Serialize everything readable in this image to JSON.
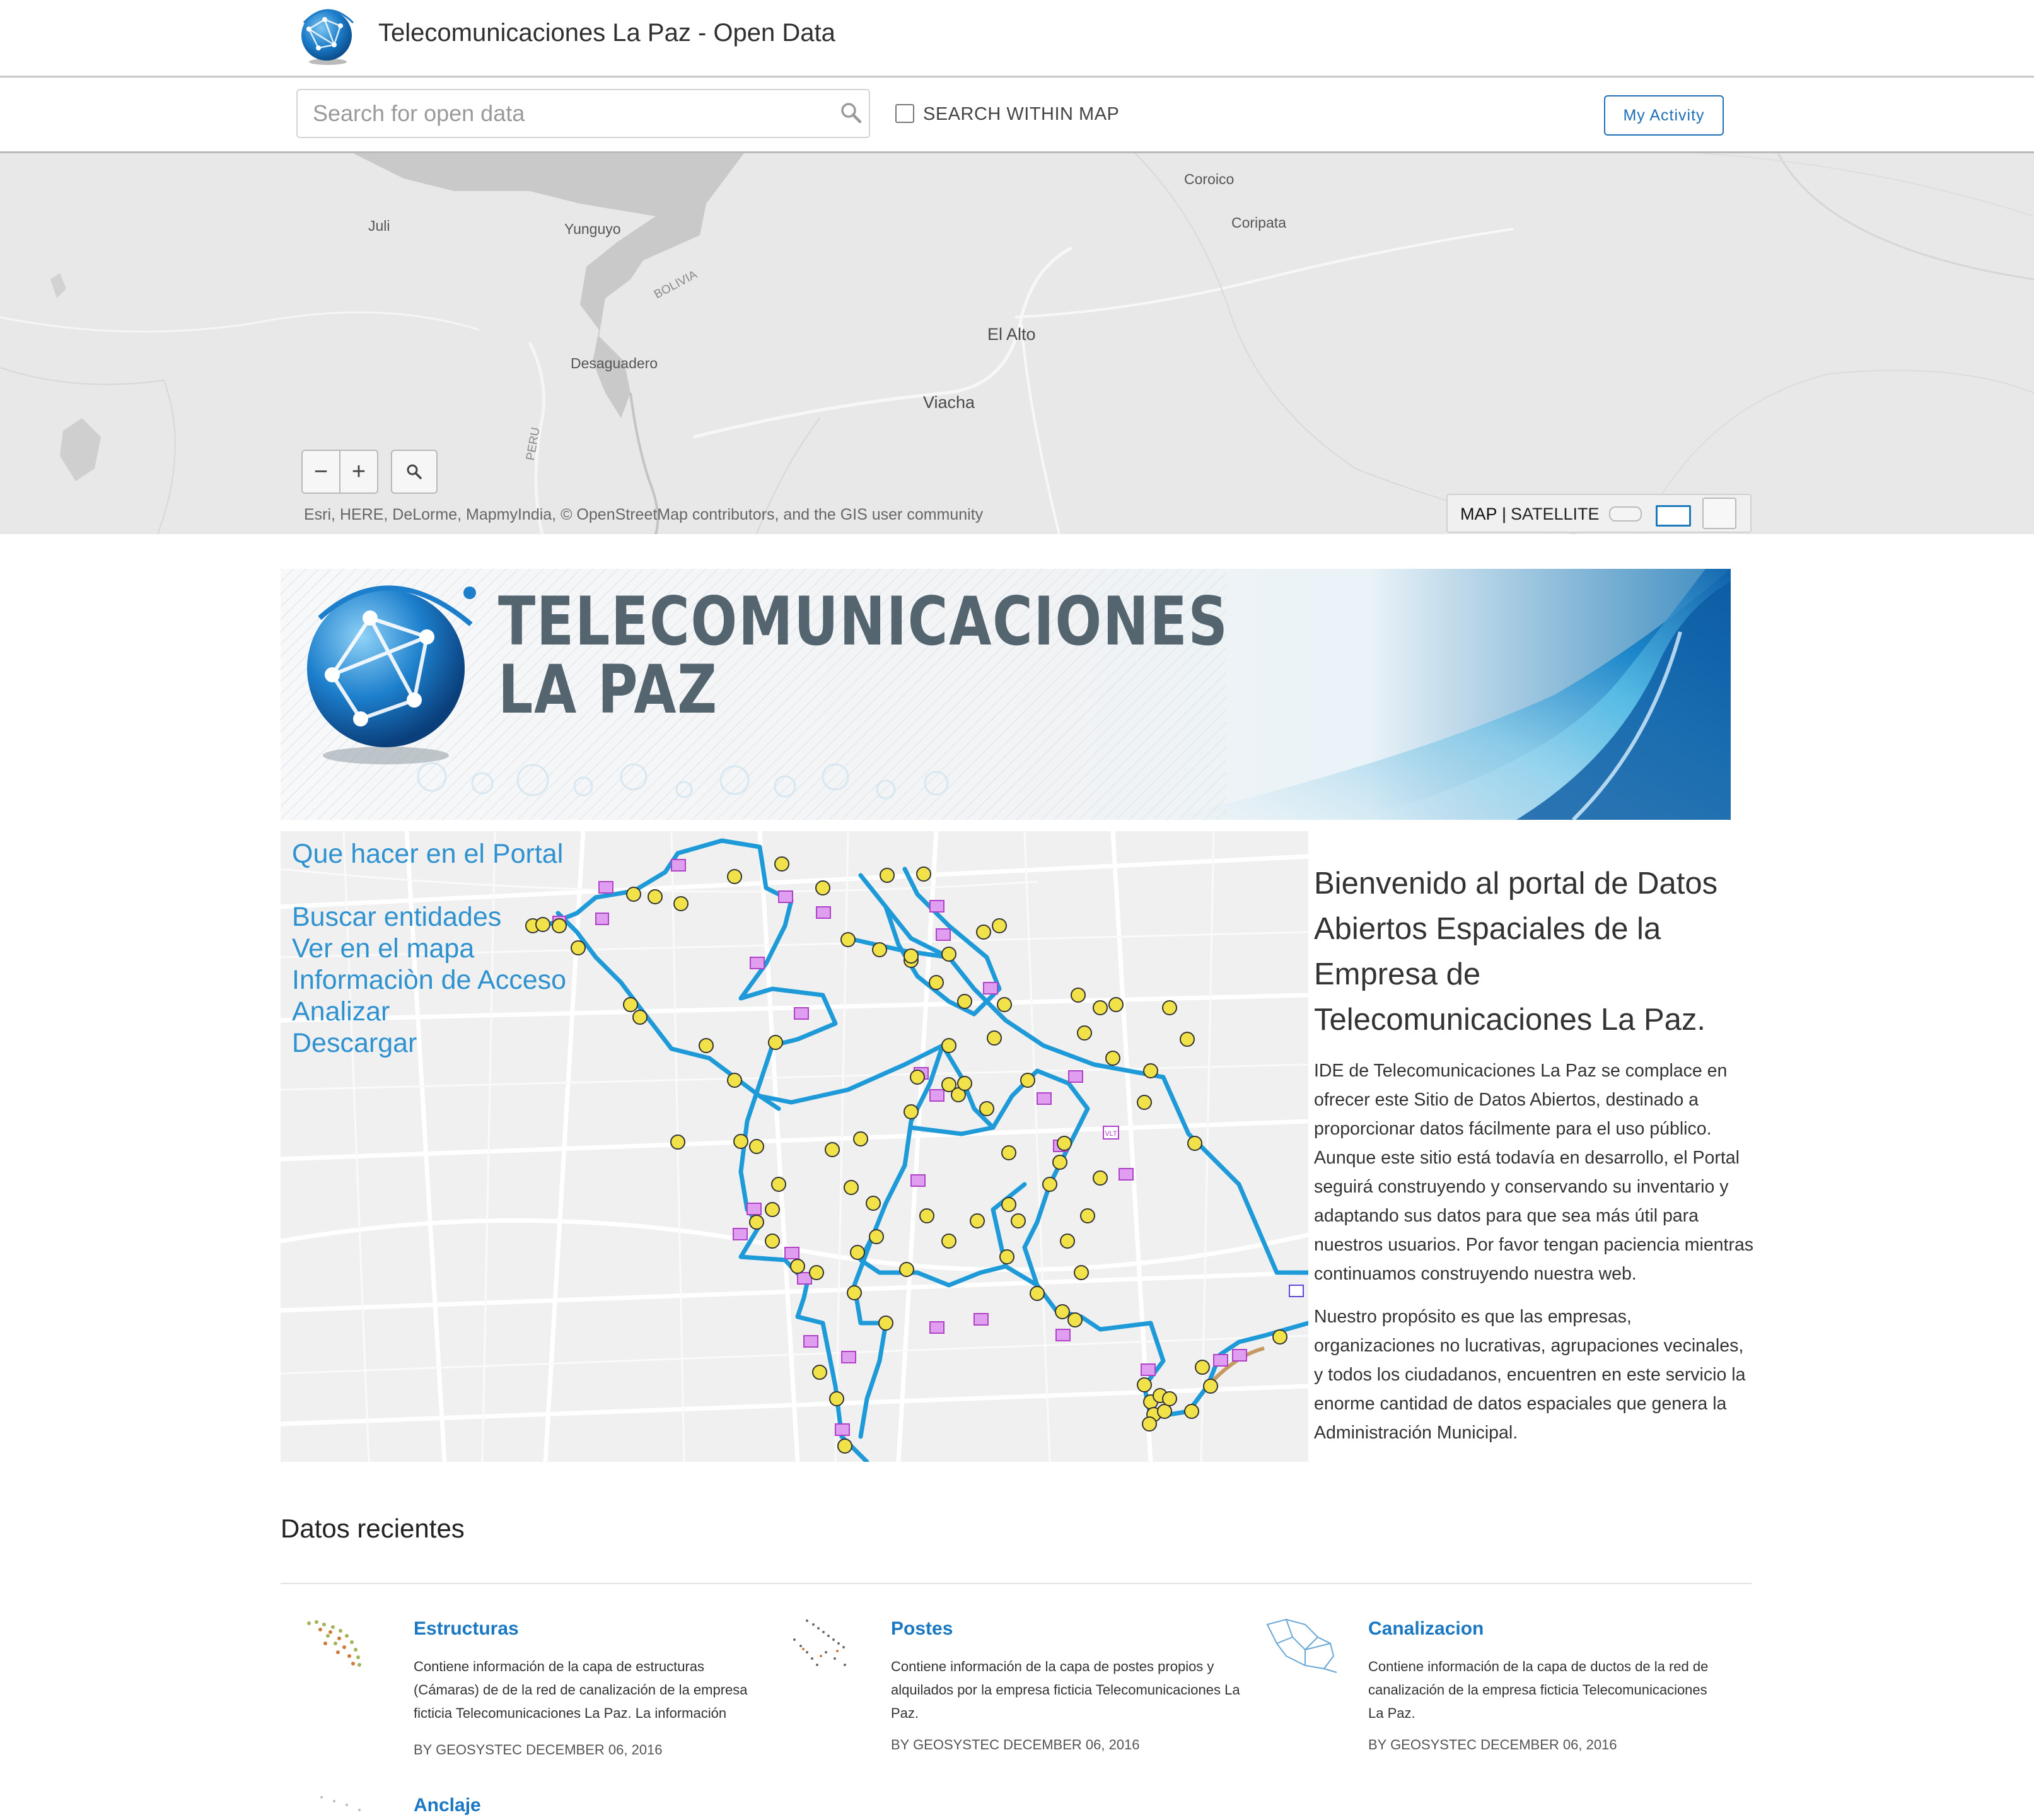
{
  "header": {
    "title": "Telecomunicaciones La Paz - Open Data"
  },
  "search": {
    "placeholder": "Search for open data",
    "within_map_label": "SEARCH WITHIN MAP",
    "my_activity_label": "My Activity"
  },
  "map": {
    "place_labels": [
      "Juli",
      "Yunguyo",
      "BOLIVIA",
      "Desaguadero",
      "PERU",
      "El Alto",
      "Viacha",
      "Coroico",
      "Coripata"
    ],
    "zoom_out": "−",
    "zoom_in": "+",
    "attribution": "Esri, HERE, DeLorme, MapmyIndia, © OpenStreetMap contributors, and the GIS user community",
    "basemap_map": "MAP",
    "basemap_separator": "|",
    "basemap_satellite": "SATELLITE"
  },
  "banner": {
    "line1": "TELECOMUNICACIONES",
    "line2": "LA PAZ"
  },
  "portal": {
    "heading": "Que hacer en el Portal",
    "links": [
      "Buscar entidades",
      "Ver en el mapa",
      "Informaciòn de Acceso",
      "Analizar",
      "Descargar"
    ],
    "map_marker_label": "VLT"
  },
  "welcome": {
    "heading": "Bienvenido al portal de Datos Abiertos Espaciales de la Empresa de Telecomunicaciones La Paz.",
    "paragraph1": "IDE de Telecomunicaciones La Paz se complace en ofrecer este Sitio de Datos Abiertos, destinado a proporcionar datos fácilmente para el uso público. Aunque este sitio está todavía en desarrollo, el Portal seguirá construyendo y conservando su inventario y adaptando sus datos para que sea más útil para nuestros usuarios. Por favor tengan paciencia mientras continuamos construyendo nuestra web.",
    "paragraph2": "Nuestro propósito es que las empresas, organizaciones no lucrativas, agrupaciones vecinales, y todos los ciudadanos, encuentren en este servicio la enorme cantidad de datos espaciales que genera la Administración Municipal."
  },
  "recent": {
    "heading": "Datos recientes",
    "items": [
      {
        "title": "Estructuras",
        "description": "Contiene información de la capa de estructuras (Cámaras) de de la red de canalización de la empresa ficticia Telecomunicaciones La Paz. La información",
        "meta": "BY GEOSYSTEC DECEMBER 06, 2016"
      },
      {
        "title": "Postes",
        "description": "Contiene información de la capa de postes propios y alquilados por la empresa ficticia Telecomunicaciones La Paz.",
        "meta": "BY GEOSYSTEC DECEMBER 06, 2016"
      },
      {
        "title": "Canalizacion",
        "description": "Contiene información de la capa de ductos de la red de canalización de la empresa ficticia Telecomunicaciones La Paz.",
        "meta": "BY GEOSYSTEC DECEMBER 06, 2016"
      },
      {
        "title": "Anclaje"
      }
    ]
  },
  "colors": {
    "link_blue": "#1a78c2",
    "route_blue": "#1e9ad8",
    "portal_link_blue": "#2f92d0",
    "button_blue": "#1e6fb5"
  }
}
